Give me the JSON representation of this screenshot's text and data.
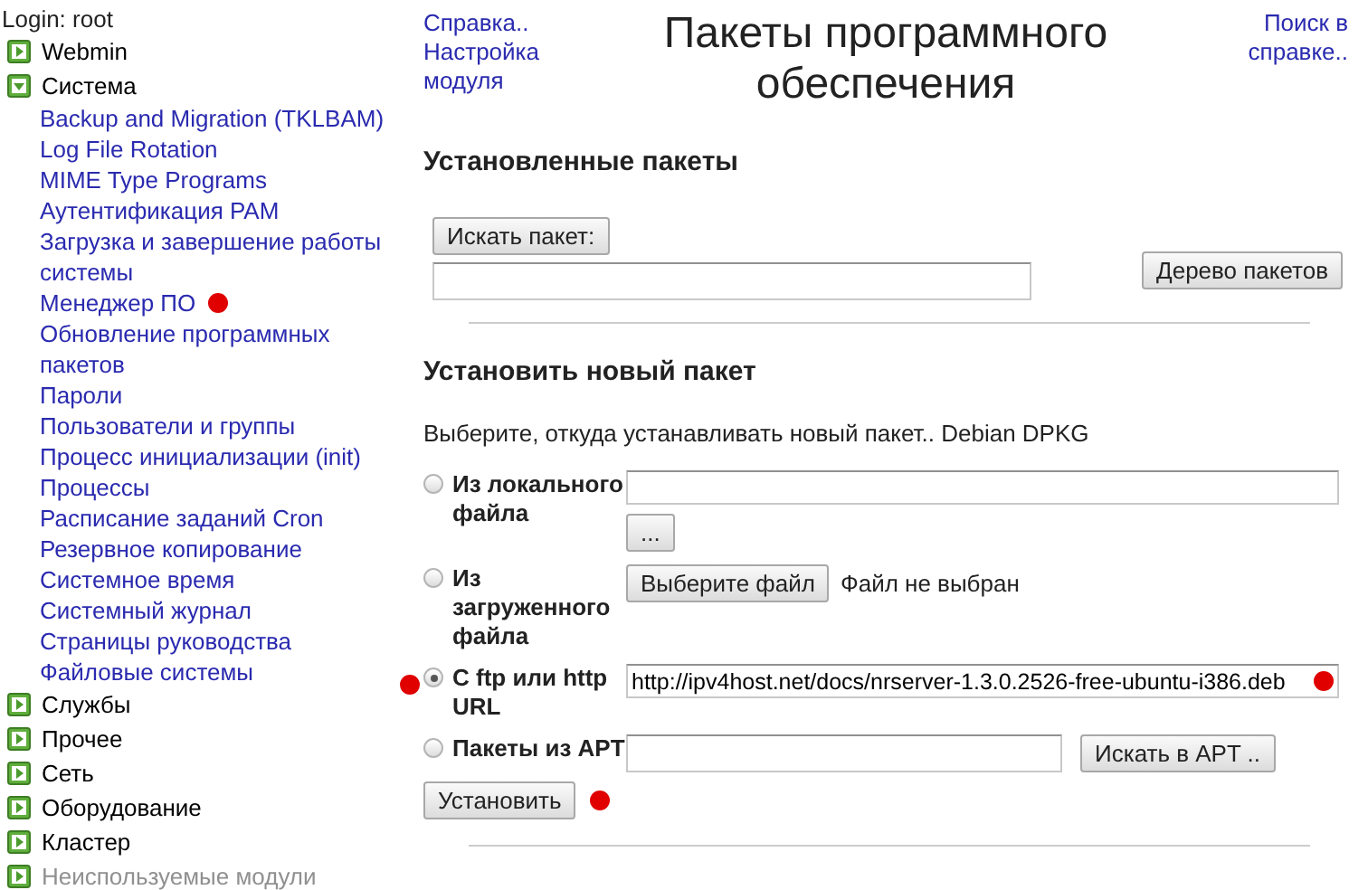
{
  "sidebar": {
    "login": "Login: root",
    "categories": [
      {
        "label": "Webmin",
        "expanded": false,
        "disabled": false
      },
      {
        "label": "Система",
        "expanded": true,
        "disabled": false,
        "items": [
          {
            "label": "Backup and Migration (TKLBAM)",
            "marked": false
          },
          {
            "label": "Log File Rotation",
            "marked": false
          },
          {
            "label": "MIME Type Programs",
            "marked": false
          },
          {
            "label": "Аутентификация PAM",
            "marked": false
          },
          {
            "label": "Загрузка и завершение работы системы",
            "marked": false
          },
          {
            "label": "Менеджер ПО",
            "marked": true
          },
          {
            "label": "Обновление программных пакетов",
            "marked": false
          },
          {
            "label": "Пароли",
            "marked": false
          },
          {
            "label": "Пользователи и группы",
            "marked": false
          },
          {
            "label": "Процесс инициализации (init)",
            "marked": false
          },
          {
            "label": "Процессы",
            "marked": false
          },
          {
            "label": "Расписание заданий Cron",
            "marked": false
          },
          {
            "label": "Резервное копирование",
            "marked": false
          },
          {
            "label": "Системное время",
            "marked": false
          },
          {
            "label": "Системный журнал",
            "marked": false
          },
          {
            "label": "Страницы руководства",
            "marked": false
          },
          {
            "label": "Файловые системы",
            "marked": false
          }
        ]
      },
      {
        "label": "Службы",
        "expanded": false,
        "disabled": false
      },
      {
        "label": "Прочее",
        "expanded": false,
        "disabled": false
      },
      {
        "label": "Сеть",
        "expanded": false,
        "disabled": false
      },
      {
        "label": "Оборудование",
        "expanded": false,
        "disabled": false
      },
      {
        "label": "Кластер",
        "expanded": false,
        "disabled": false
      },
      {
        "label": "Неиспользуемые модули",
        "expanded": false,
        "disabled": true
      }
    ]
  },
  "header": {
    "left_links": [
      "Справка..",
      "Настройка модуля"
    ],
    "title": "Пакеты программного обеспечения",
    "right_link": "Поиск в справке.."
  },
  "installed": {
    "heading": "Установленные пакеты",
    "search_button": "Искать пакет:",
    "tree_button": "Дерево пакетов"
  },
  "install": {
    "heading": "Установить новый пакет",
    "description": "Выберите, откуда устанавливать новый пакет.. Debian DPKG",
    "sources": [
      {
        "kind": "local",
        "label": "Из локального файла",
        "selected": false,
        "button": "..."
      },
      {
        "kind": "upload",
        "label": "Из загруженного файла",
        "selected": false,
        "button": "Выберите файл",
        "note": "Файл не выбран"
      },
      {
        "kind": "url",
        "label": "С ftp или http URL",
        "selected": true,
        "marked": true,
        "field": {
          "value": "http://ipv4host.net/docs/nrserver-1.3.0.2526-free-ubuntu-i386.deb",
          "marked": true
        }
      },
      {
        "kind": "apt",
        "label": "Пакеты из APT",
        "selected": false,
        "button": "Искать в APT .."
      }
    ],
    "submit": {
      "label": "Установить",
      "marked": true
    }
  }
}
